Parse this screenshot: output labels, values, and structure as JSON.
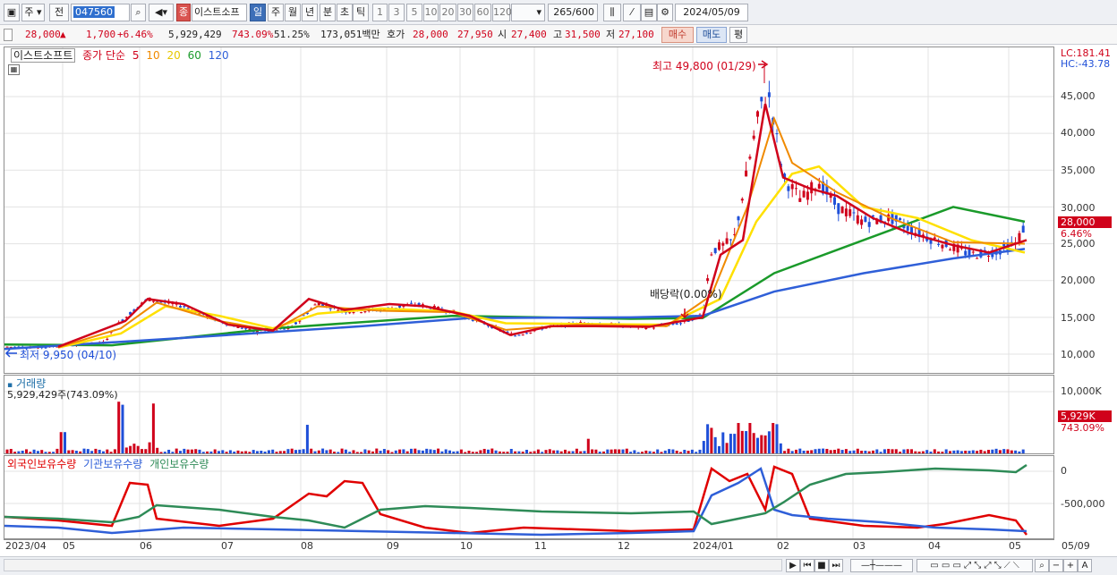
{
  "toolbar": {
    "type_label": "주",
    "market_label": "전",
    "stock_code": "047560",
    "stock_name_badge": "종",
    "stock_name": "이스트소프",
    "periods": [
      "일",
      "주",
      "월",
      "년",
      "분",
      "초",
      "틱"
    ],
    "intervals": [
      "1",
      "3",
      "5",
      "10",
      "20",
      "30",
      "60",
      "120"
    ],
    "count": "265",
    "count_total": "/600",
    "date": "2024/05/09"
  },
  "quote": {
    "price": "28,000",
    "change": "1,700",
    "change_pct": "+6.46%",
    "volume": "5,929,429",
    "volume_ratio": "743.09%",
    "turnover_ratio": "51.25%",
    "trade_value": "173,051백만",
    "bid_label": "호가",
    "ask_price": "28,000",
    "bid_price": "27,950",
    "open_label": "시",
    "open": "27,400",
    "high_label": "고",
    "high": "31,500",
    "low_label": "저",
    "low": "27,100",
    "buy_label": "매수",
    "sell_label": "매도",
    "eval_label": "평"
  },
  "price_pane": {
    "stock_label": "이스트소프트",
    "ma_title": "종가 단순",
    "ma_periods": [
      "5",
      "10",
      "20",
      "60",
      "120"
    ],
    "lc": "LC:181.41",
    "hc": "HC:-43.78",
    "y_ticks": [
      "45,000",
      "40,000",
      "35,000",
      "30,000",
      "25,000",
      "20,000",
      "15,000",
      "10,000"
    ],
    "current_price": "28,000",
    "current_pct": "6.46%",
    "high_annotation": "최고 49,800 (01/29)",
    "low_annotation": "최저 9,950 (04/10)",
    "dividend_annotation": "배당락(0.00%)"
  },
  "volume_pane": {
    "title": "거래량",
    "summary": "5,929,429주(743.09%)",
    "y_tick": "10,000K",
    "current": "5,929K",
    "current_pct": "743.09%"
  },
  "holdings_pane": {
    "series": [
      "외국인보유수량",
      "기관보유수량",
      "개인보유수량"
    ],
    "y_ticks": [
      "0",
      "-500,000"
    ]
  },
  "x_axis": {
    "labels": [
      "2023/04",
      "05",
      "06",
      "07",
      "08",
      "09",
      "10",
      "11",
      "12",
      "2024/01",
      "02",
      "03",
      "04",
      "05",
      "05/09"
    ]
  },
  "colors": {
    "ma5": "#d0021b",
    "ma10": "#f08a00",
    "ma20": "#ffe000",
    "ma60": "#1a9a2a",
    "ma120": "#2f5fd8",
    "up": "#d0021b",
    "down": "#1f4fd8",
    "foreign": "#e00000",
    "institution": "#2f5fd8",
    "individual": "#2e8b57"
  }
}
